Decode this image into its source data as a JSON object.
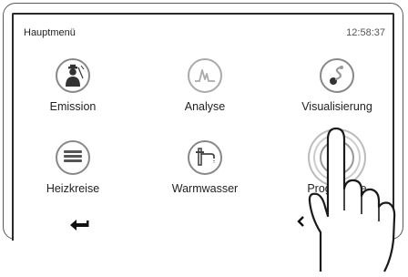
{
  "header": {
    "title": "Hauptmenü",
    "time": "12:58:37"
  },
  "menu": {
    "tiles": [
      {
        "label": "Emission",
        "icon": "chimney-sweep-icon"
      },
      {
        "label": "Analyse",
        "icon": "analysis-waveform-icon"
      },
      {
        "label": "Visualisierung",
        "icon": "visualization-icon"
      },
      {
        "label": "Heizkreise",
        "icon": "radiator-icon"
      },
      {
        "label": "Warmwasser",
        "icon": "faucet-icon"
      },
      {
        "label": "Programme",
        "icon": "program-icon",
        "pressed": true
      }
    ]
  },
  "nav": {
    "back_icon": "back-arrow-icon",
    "prev_icon": "chevron-left-icon"
  },
  "colors": {
    "icon_gray": "#888888",
    "border": "#2a2a2a"
  }
}
